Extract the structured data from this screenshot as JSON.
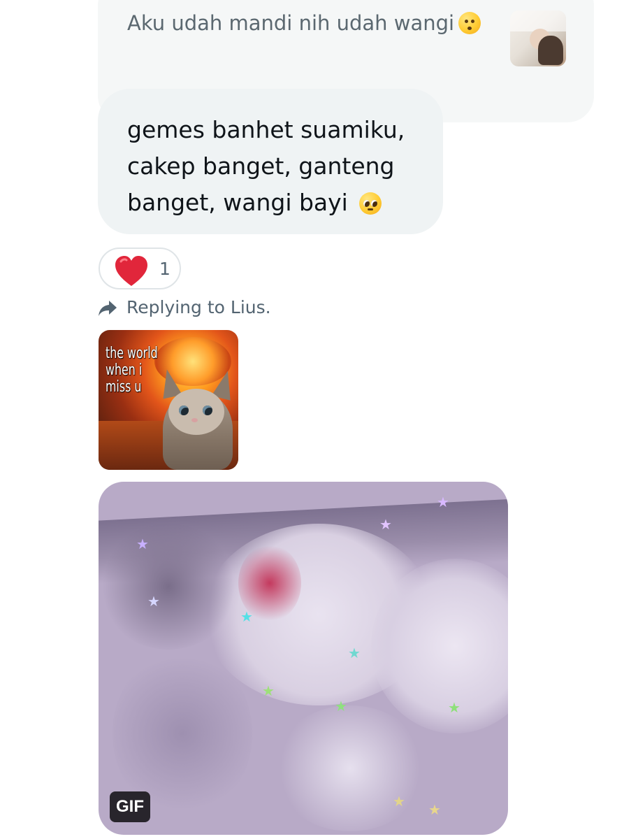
{
  "quoted_message": {
    "text": "Aku udah mandi nih udah wangi",
    "emoji_icon": "kissing-closed-eyes-emoji",
    "thumbnail_icon": "photo-thumbnail"
  },
  "message": {
    "text": "gemes banhet suamiku, cakep banget, ganteng banget, wangi bayi",
    "emoji_icon": "pleading-face-emoji"
  },
  "reaction": {
    "icon": "red-heart-icon",
    "count": "1",
    "color": "#e0245e"
  },
  "reply_context": {
    "icon": "reply-arrow-icon",
    "text": "Replying to Lius."
  },
  "meme_image": {
    "caption": "the world\nwhen i\nmiss u"
  },
  "gif": {
    "badge": "GIF"
  }
}
